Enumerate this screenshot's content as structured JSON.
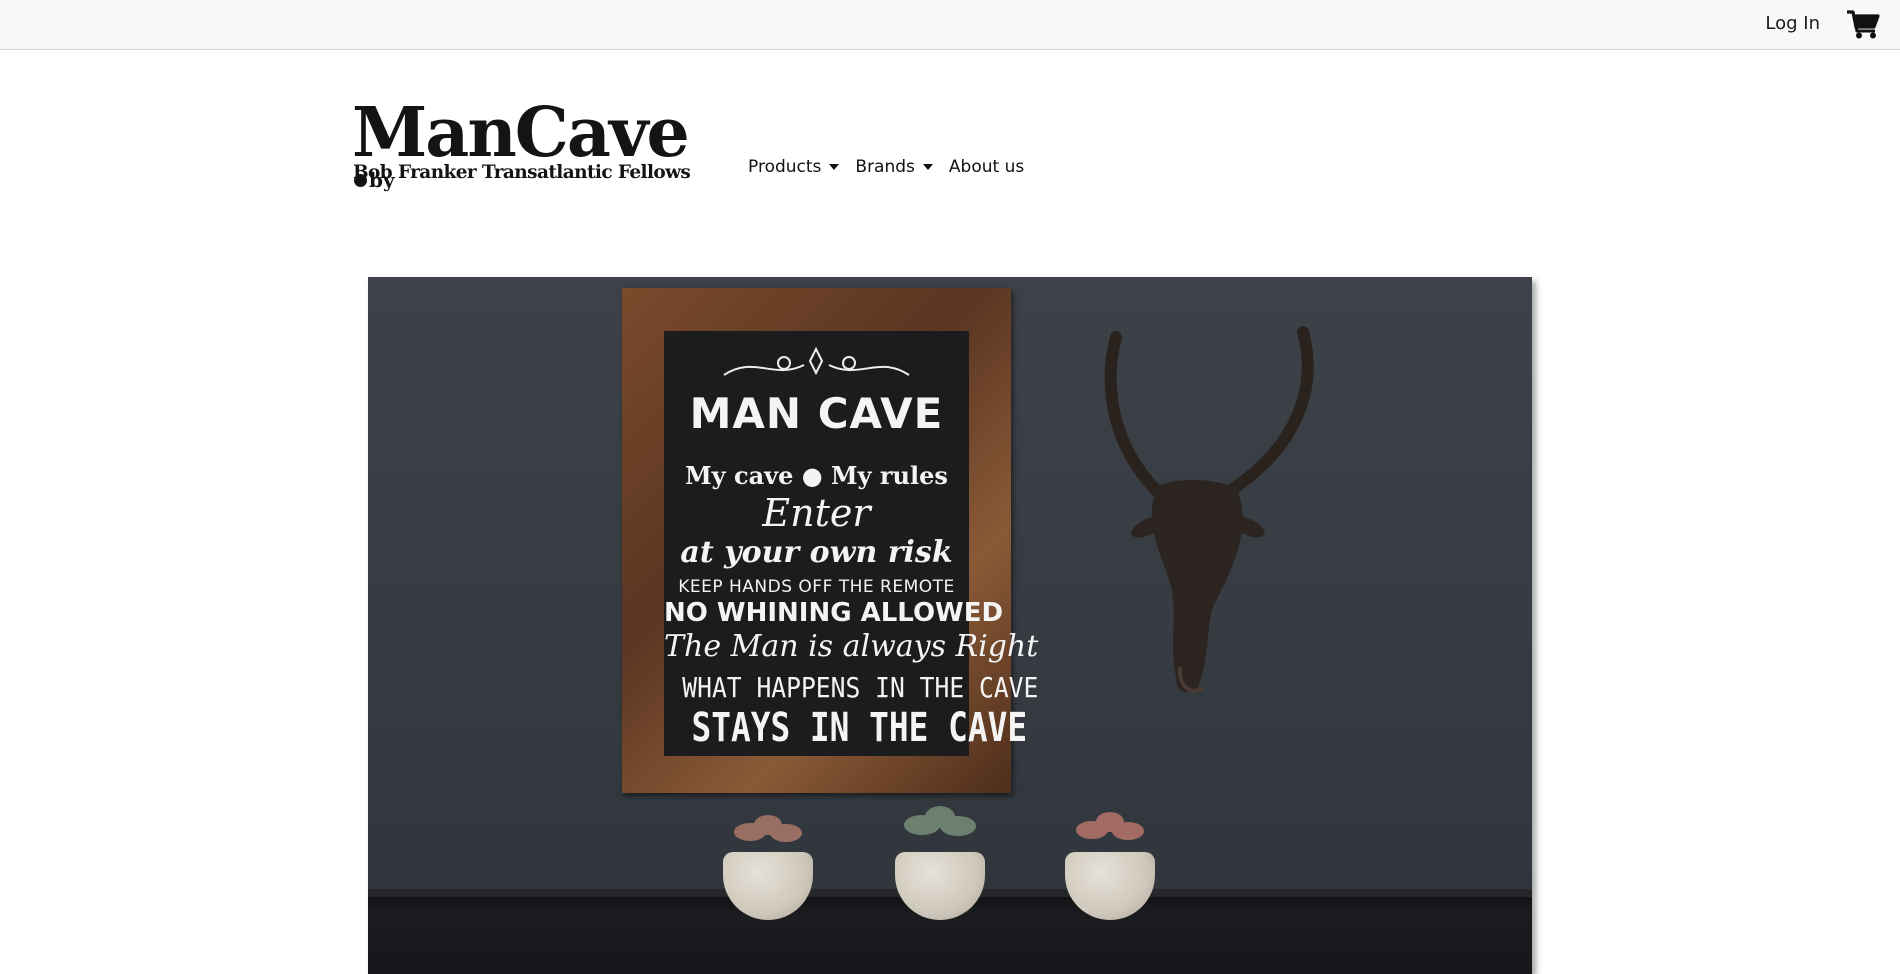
{
  "topbar": {
    "login_label": "Log In",
    "cart_icon": "shopping-cart-icon"
  },
  "brand": {
    "name": "ManCave",
    "by": "by",
    "subtitle": "Bob Franker Transatlantic Fellows"
  },
  "nav": {
    "items": [
      {
        "label": "Products",
        "has_dropdown": true
      },
      {
        "label": "Brands",
        "has_dropdown": true
      },
      {
        "label": "About us",
        "has_dropdown": false
      }
    ]
  },
  "hero": {
    "sign_lines": [
      "MAN CAVE",
      "My cave",
      "My rules",
      "Enter",
      "at your own risk",
      "KEEP HANDS OFF THE REMOTE",
      "NO WHINING ALLOWED",
      "The Man is always Right",
      "WHAT HAPPENS IN THE CAVE",
      "STAYS IN THE CAVE"
    ]
  },
  "colors": {
    "topbar_bg": "#f7f8fa",
    "wall": "#3d4249",
    "text": "#111111"
  }
}
